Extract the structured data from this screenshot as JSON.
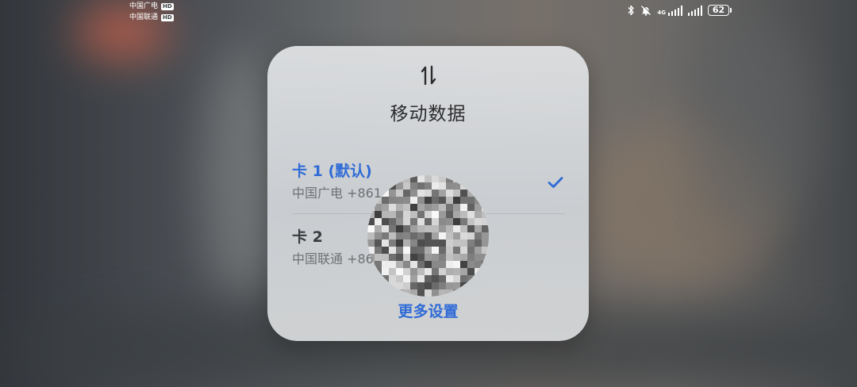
{
  "status_bar": {
    "carrier1": "中国广电",
    "carrier2": "中国联通",
    "hd_badge": "HD",
    "network_type": "4G",
    "battery_level": "62",
    "icons": [
      "bluetooth-icon",
      "mute-bell-icon",
      "signal-icon",
      "signal-icon",
      "battery-icon"
    ]
  },
  "dialog": {
    "icon": "data-transfer-icon",
    "title": "移动数据",
    "sims": [
      {
        "name": "卡 1 (默认)",
        "subtitle": "中国广电 +861",
        "selected": true
      },
      {
        "name": "卡 2",
        "subtitle": "中国联通 +86",
        "selected": false
      }
    ],
    "more_settings": "更多设置"
  },
  "colors": {
    "accent": "#2f6bd6",
    "dialog_bg": "#d3d6d8",
    "text_primary": "#2b2c2d",
    "text_secondary": "#6f7173"
  }
}
